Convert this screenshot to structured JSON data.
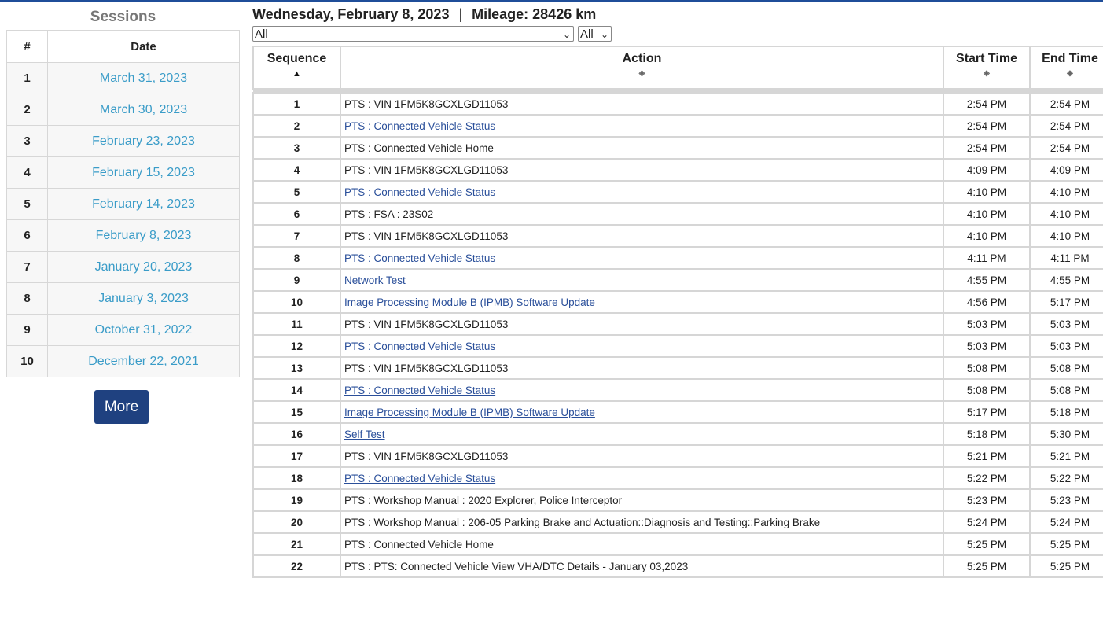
{
  "sidebar": {
    "title": "Sessions",
    "headers": {
      "num": "#",
      "date": "Date"
    },
    "sessions": [
      {
        "num": "1",
        "date": "March 31, 2023"
      },
      {
        "num": "2",
        "date": "March 30, 2023"
      },
      {
        "num": "3",
        "date": "February 23, 2023"
      },
      {
        "num": "4",
        "date": "February 15, 2023"
      },
      {
        "num": "5",
        "date": "February 14, 2023"
      },
      {
        "num": "6",
        "date": "February 8, 2023"
      },
      {
        "num": "7",
        "date": "January 20, 2023"
      },
      {
        "num": "8",
        "date": "January 3, 2023"
      },
      {
        "num": "9",
        "date": "October 31, 2022"
      },
      {
        "num": "10",
        "date": "December 22, 2021"
      }
    ],
    "more_label": "More"
  },
  "header": {
    "date": "Wednesday, February 8, 2023",
    "separator": "|",
    "mileage": "Mileage: 28426 km"
  },
  "filters": {
    "action_filter": "All",
    "type_filter": "All"
  },
  "table": {
    "columns": {
      "sequence": "Sequence",
      "action": "Action",
      "start": "Start Time",
      "end": "End Time"
    },
    "rows": [
      {
        "seq": "1",
        "action": "PTS : VIN 1FM5K8GCXLGD11053",
        "link": false,
        "start": "2:54 PM",
        "end": "2:54 PM"
      },
      {
        "seq": "2",
        "action": "PTS : Connected Vehicle Status",
        "link": true,
        "start": "2:54 PM",
        "end": "2:54 PM"
      },
      {
        "seq": "3",
        "action": "PTS : Connected Vehicle Home",
        "link": false,
        "start": "2:54 PM",
        "end": "2:54 PM"
      },
      {
        "seq": "4",
        "action": "PTS : VIN 1FM5K8GCXLGD11053",
        "link": false,
        "start": "4:09 PM",
        "end": "4:09 PM"
      },
      {
        "seq": "5",
        "action": "PTS : Connected Vehicle Status",
        "link": true,
        "start": "4:10 PM",
        "end": "4:10 PM"
      },
      {
        "seq": "6",
        "action": "PTS : FSA : 23S02",
        "link": false,
        "start": "4:10 PM",
        "end": "4:10 PM"
      },
      {
        "seq": "7",
        "action": "PTS : VIN 1FM5K8GCXLGD11053",
        "link": false,
        "start": "4:10 PM",
        "end": "4:10 PM"
      },
      {
        "seq": "8",
        "action": "PTS : Connected Vehicle Status",
        "link": true,
        "start": "4:11 PM",
        "end": "4:11 PM"
      },
      {
        "seq": "9",
        "action": "Network Test",
        "link": true,
        "start": "4:55 PM",
        "end": "4:55 PM"
      },
      {
        "seq": "10",
        "action": "Image Processing Module B (IPMB) Software Update",
        "link": true,
        "start": "4:56 PM",
        "end": "5:17 PM"
      },
      {
        "seq": "11",
        "action": "PTS : VIN 1FM5K8GCXLGD11053",
        "link": false,
        "start": "5:03 PM",
        "end": "5:03 PM"
      },
      {
        "seq": "12",
        "action": "PTS : Connected Vehicle Status",
        "link": true,
        "start": "5:03 PM",
        "end": "5:03 PM"
      },
      {
        "seq": "13",
        "action": "PTS : VIN 1FM5K8GCXLGD11053",
        "link": false,
        "start": "5:08 PM",
        "end": "5:08 PM"
      },
      {
        "seq": "14",
        "action": "PTS : Connected Vehicle Status",
        "link": true,
        "start": "5:08 PM",
        "end": "5:08 PM"
      },
      {
        "seq": "15",
        "action": "Image Processing Module B (IPMB) Software Update",
        "link": true,
        "start": "5:17 PM",
        "end": "5:18 PM"
      },
      {
        "seq": "16",
        "action": "Self Test",
        "link": true,
        "start": "5:18 PM",
        "end": "5:30 PM"
      },
      {
        "seq": "17",
        "action": "PTS : VIN 1FM5K8GCXLGD11053",
        "link": false,
        "start": "5:21 PM",
        "end": "5:21 PM"
      },
      {
        "seq": "18",
        "action": "PTS : Connected Vehicle Status",
        "link": true,
        "start": "5:22 PM",
        "end": "5:22 PM"
      },
      {
        "seq": "19",
        "action": "PTS : Workshop Manual : 2020 Explorer, Police Interceptor",
        "link": false,
        "start": "5:23 PM",
        "end": "5:23 PM"
      },
      {
        "seq": "20",
        "action": "PTS : Workshop Manual : 206-05 Parking Brake and Actuation::Diagnosis and Testing::Parking Brake",
        "link": false,
        "start": "5:24 PM",
        "end": "5:24 PM"
      },
      {
        "seq": "21",
        "action": "PTS : Connected Vehicle Home",
        "link": false,
        "start": "5:25 PM",
        "end": "5:25 PM"
      },
      {
        "seq": "22",
        "action": "PTS : PTS: Connected Vehicle View VHA/DTC Details - January 03,2023",
        "link": false,
        "start": "5:25 PM",
        "end": "5:25 PM"
      }
    ]
  }
}
